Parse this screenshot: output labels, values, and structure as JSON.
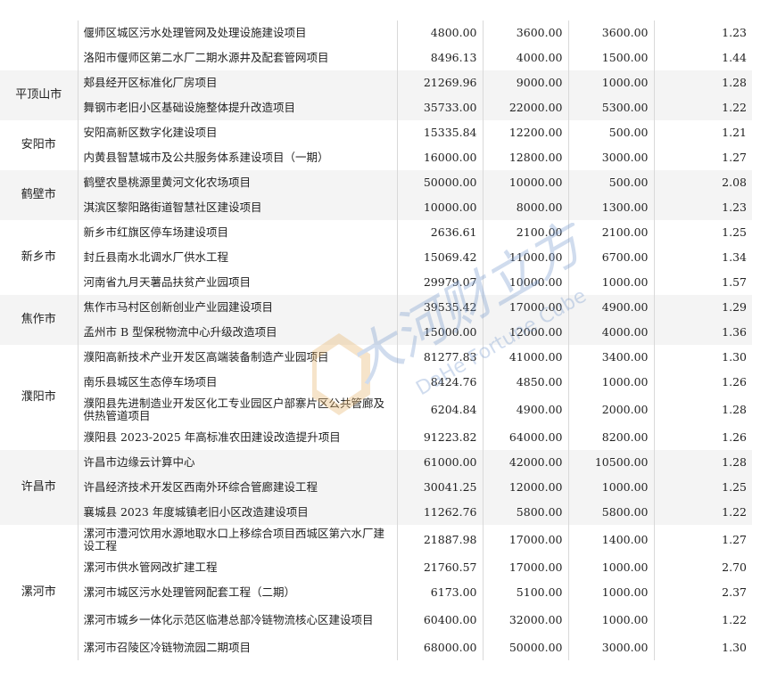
{
  "groups": [
    {
      "city": "",
      "shade": false,
      "rows": [
        {
          "name": "偃师区城区污水处理管网及处理设施建设项目",
          "c1": "4800.00",
          "c2": "3600.00",
          "c3": "3600.00",
          "c4": "1.23",
          "h": 28
        },
        {
          "name": "洛阳市偃师区第二水厂二期水源井及配套管网项目",
          "c1": "8496.13",
          "c2": "4000.00",
          "c3": "1500.00",
          "c4": "1.44",
          "h": 28
        }
      ]
    },
    {
      "city": "平顶山市",
      "shade": true,
      "rows": [
        {
          "name": "郏县经开区标准化厂房项目",
          "c1": "21269.96",
          "c2": "9000.00",
          "c3": "1000.00",
          "c4": "1.28",
          "h": 28
        },
        {
          "name": "舞钢市老旧小区基础设施整体提升改造项目",
          "c1": "35733.00",
          "c2": "22000.00",
          "c3": "5300.00",
          "c4": "1.22",
          "h": 28
        }
      ]
    },
    {
      "city": "安阳市",
      "shade": false,
      "rows": [
        {
          "name": "安阳高新区数字化建设项目",
          "c1": "15335.84",
          "c2": "12200.00",
          "c3": "500.00",
          "c4": "1.21",
          "h": 28
        },
        {
          "name": "内黄县智慧城市及公共服务体系建设项目（一期）",
          "c1": "16000.00",
          "c2": "12800.00",
          "c3": "3000.00",
          "c4": "1.27",
          "h": 28
        }
      ]
    },
    {
      "city": "鹤壁市",
      "shade": true,
      "rows": [
        {
          "name": "鹤壁农垦桃源里黄河文化农场项目",
          "c1": "50000.00",
          "c2": "10000.00",
          "c3": "500.00",
          "c4": "2.08",
          "h": 28
        },
        {
          "name": "淇滨区黎阳路街道智慧社区建设项目",
          "c1": "10000.00",
          "c2": "8000.00",
          "c3": "1300.00",
          "c4": "1.23",
          "h": 28
        }
      ]
    },
    {
      "city": "新乡市",
      "shade": false,
      "rows": [
        {
          "name": "新乡市红旗区停车场建设项目",
          "c1": "2636.61",
          "c2": "2100.00",
          "c3": "2100.00",
          "c4": "1.25",
          "h": 28
        },
        {
          "name": "封丘县南水北调水厂供水工程",
          "c1": "15069.42",
          "c2": "11000.00",
          "c3": "6700.00",
          "c4": "1.34",
          "h": 28
        },
        {
          "name": "河南省九月天薯品扶贫产业园项目",
          "c1": "29979.07",
          "c2": "10000.00",
          "c3": "1000.00",
          "c4": "1.57",
          "h": 28
        }
      ]
    },
    {
      "city": "焦作市",
      "shade": true,
      "rows": [
        {
          "name": "焦作市马村区创新创业产业园建设项目",
          "c1": "39535.42",
          "c2": "17000.00",
          "c3": "4900.00",
          "c4": "1.29",
          "h": 28
        },
        {
          "name": "孟州市 B 型保税物流中心升级改造项目",
          "c1": "15000.00",
          "c2": "12000.00",
          "c3": "4000.00",
          "c4": "1.36",
          "h": 28
        }
      ]
    },
    {
      "city": "濮阳市",
      "shade": false,
      "rows": [
        {
          "name": "濮阳高新技术产业开发区高端装备制造产业园项目",
          "c1": "81277.83",
          "c2": "41000.00",
          "c3": "3400.00",
          "c4": "1.30",
          "h": 28
        },
        {
          "name": "南乐县城区生态停车场项目",
          "c1": "8424.76",
          "c2": "4850.00",
          "c3": "1000.00",
          "c4": "1.26",
          "h": 28
        },
        {
          "name": "濮阳县先进制造业开发区化工专业园区户部寨片区公共管廊及供热管道项目",
          "c1": "6204.84",
          "c2": "4900.00",
          "c3": "2000.00",
          "c4": "1.28",
          "h": 34
        },
        {
          "name": "濮阳县 2023-2025 年高标准农田建设改造提升项目",
          "c1": "91223.82",
          "c2": "64000.00",
          "c3": "8200.00",
          "c4": "1.26",
          "h": 28
        }
      ]
    },
    {
      "city": "许昌市",
      "shade": true,
      "rows": [
        {
          "name": "许昌市边缘云计算中心",
          "c1": "61000.00",
          "c2": "42000.00",
          "c3": "10500.00",
          "c4": "1.28",
          "h": 28
        },
        {
          "name": "许昌经济技术开发区西南外环综合管廊建设工程",
          "c1": "30041.25",
          "c2": "12000.00",
          "c3": "1000.00",
          "c4": "1.25",
          "h": 28
        },
        {
          "name": "襄城县 2023 年度城镇老旧小区改造建设项目",
          "c1": "11262.76",
          "c2": "5800.00",
          "c3": "5800.00",
          "c4": "1.22",
          "h": 28
        }
      ]
    },
    {
      "city": "漯河市",
      "shade": false,
      "rows": [
        {
          "name": "漯河市澧河饮用水源地取水口上移综合项目西城区第六水厂建设工程",
          "c1": "21887.98",
          "c2": "17000.00",
          "c3": "1400.00",
          "c4": "1.27",
          "h": 34
        },
        {
          "name": "漯河市供水管网改扩建工程",
          "c1": "21760.57",
          "c2": "17000.00",
          "c3": "1000.00",
          "c4": "2.70",
          "h": 28
        },
        {
          "name": "漯河市城区污水处理管网配套工程（二期）",
          "c1": "6173.00",
          "c2": "5100.00",
          "c3": "1000.00",
          "c4": "2.37",
          "h": 28
        },
        {
          "name": "漯河市城乡一体化示范区临港总部冷链物流核心区建设项目",
          "c1": "60400.00",
          "c2": "32000.00",
          "c3": "1000.00",
          "c4": "1.22",
          "h": 34
        },
        {
          "name": "漯河市召陵区冷链物流园二期项目",
          "c1": "68000.00",
          "c2": "50000.00",
          "c3": "3000.00",
          "c4": "1.30",
          "h": 28
        }
      ]
    }
  ],
  "watermark": {
    "text_cn": "大河财立方",
    "text_en": "DaHe Fortune Cube",
    "color": "#7a9ccf",
    "accent": "#e8b46a"
  }
}
